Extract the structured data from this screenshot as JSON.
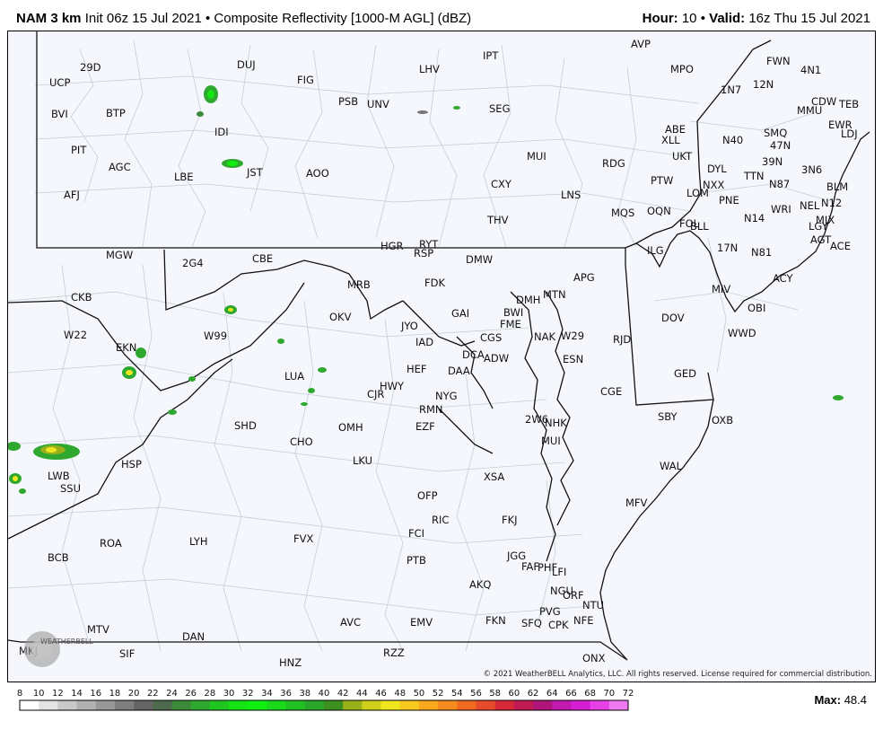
{
  "header": {
    "model": "NAM 3 km",
    "init": "Init 06z 15 Jul 2021",
    "bullet": "•",
    "product": "Composite Reflectivity [1000-M AGL] (dBZ)",
    "hour_label": "Hour:",
    "hour_value": "10",
    "valid_label": "Valid:",
    "valid_value": "16z Thu 15 Jul 2021"
  },
  "map": {
    "copyright": "© 2021 WeatherBELL Analytics, LLC. All rights reserved. License required for commercial distribution.",
    "logo_text": "WEATHERBELL",
    "stations": [
      "29D",
      "DUJ",
      "UCP",
      "FIG",
      "LHV",
      "IPT",
      "AVP",
      "MPO",
      "FWN",
      "4N1",
      "1N7",
      "12N",
      "BVI",
      "BTP",
      "PSB",
      "UNV",
      "SEG",
      "MMU",
      "CDW",
      "TEB",
      "IDI",
      "ABE",
      "XLL",
      "EWR",
      "LDJ",
      "SMQ",
      "N40",
      "47N",
      "PIT",
      "MUI",
      "UKT",
      "39N",
      "AGC",
      "JST",
      "AOO",
      "RDG",
      "DYL",
      "3N6",
      "LBE",
      "CXY",
      "TTN",
      "N87",
      "AFJ",
      "PTW",
      "NXX",
      "BLM",
      "LNS",
      "LOM",
      "PNE",
      "N12",
      "THV",
      "MQS",
      "OQN",
      "WRI",
      "NEL",
      "MJX",
      "LGY",
      "FOL",
      "BLL",
      "N14",
      "HGR",
      "RYT",
      "AGT",
      "MGW",
      "RSP",
      "ACE",
      "2G4",
      "CBE",
      "DMW",
      "ILG",
      "17N",
      "N81",
      "FDK",
      "APG",
      "ACY",
      "MRB",
      "DMH",
      "MTN",
      "CKB",
      "MIV",
      "GAI",
      "BWI",
      "OBI",
      "OKV",
      "JYO",
      "FME",
      "DOV",
      "W22",
      "NAK",
      "W29",
      "RJD",
      "WWD",
      "EKN",
      "W99",
      "IAD",
      "CGS",
      "DCA",
      "ADW",
      "ESN",
      "HEF",
      "DAA",
      "GED",
      "LUA",
      "HWY",
      "CGE",
      "CJR",
      "NYG",
      "RMN",
      "SBY",
      "2W6",
      "NHK",
      "OXB",
      "SHD",
      "OMH",
      "EZF",
      "CHO",
      "MUI",
      "LKU",
      "HSP",
      "WAL",
      "LWB",
      "XSA",
      "SSU",
      "MFV",
      "OFP",
      "RIC",
      "FKJ",
      "ROA",
      "LYH",
      "FVX",
      "FCI",
      "BCB",
      "PTB",
      "JGG",
      "FAF",
      "PHF",
      "LFI",
      "AKQ",
      "NGU",
      "ORF",
      "MTV",
      "AVC",
      "EMV",
      "PVG",
      "NTU",
      "FKN",
      "SFQ",
      "CPK",
      "NFE",
      "DAN",
      "SIF",
      "HNZ",
      "RZZ",
      "ONX",
      "MKJ"
    ]
  },
  "legend": {
    "ticks": [
      "8",
      "10",
      "12",
      "14",
      "16",
      "18",
      "20",
      "22",
      "24",
      "26",
      "28",
      "30",
      "32",
      "34",
      "36",
      "38",
      "40",
      "42",
      "44",
      "46",
      "48",
      "50",
      "52",
      "54",
      "56",
      "58",
      "60",
      "62",
      "64",
      "66",
      "68",
      "70",
      "72"
    ],
    "colors": [
      "#ffffff",
      "#e3e3e3",
      "#c9c9c9",
      "#b1b1b1",
      "#989898",
      "#7e7e7e",
      "#656565",
      "#4d6a4d",
      "#3a8a3a",
      "#2ea82e",
      "#1fc61f",
      "#14e314",
      "#10f010",
      "#1ad81a",
      "#22bf22",
      "#2aa62a",
      "#3d8f1f",
      "#9ab01a",
      "#cfd01c",
      "#f0e61e",
      "#f7c81e",
      "#f9a81e",
      "#f58a1e",
      "#ef6a1e",
      "#e54a2a",
      "#d62a3a",
      "#c21a55",
      "#b0157a",
      "#c11ab0",
      "#d41ed4",
      "#e640e6",
      "#f078f0",
      "#f7aaf7"
    ],
    "max_label": "Max:",
    "max_value": "48.4"
  },
  "colors": {
    "map_bg": "#f5f7fc",
    "county_lines": "#c4c8d0",
    "state_lines": "#222222"
  }
}
